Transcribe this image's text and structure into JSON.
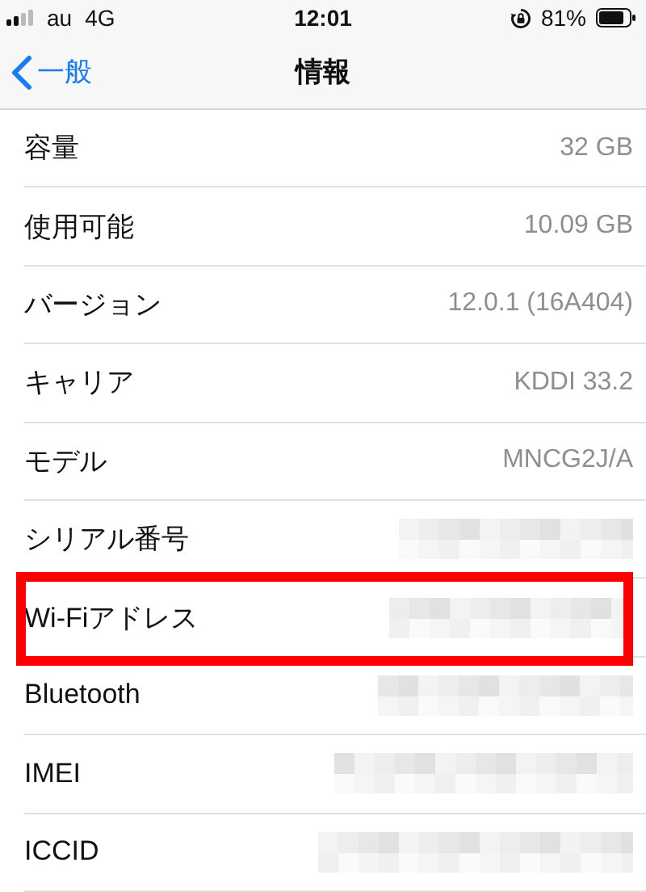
{
  "status_bar": {
    "carrier": "au",
    "network": "4G",
    "time": "12:01",
    "battery_percent": "81%"
  },
  "nav_bar": {
    "back_label": "一般",
    "title": "情報"
  },
  "rows": [
    {
      "label": "容量",
      "kind": "text",
      "value": "32 GB",
      "highlighted": false
    },
    {
      "label": "使用可能",
      "kind": "text",
      "value": "10.09 GB",
      "highlighted": false
    },
    {
      "label": "バージョン",
      "kind": "text",
      "value": "12.0.1 (16A404)",
      "highlighted": false
    },
    {
      "label": "キャリア",
      "kind": "text",
      "value": "KDDI 33.2",
      "highlighted": false
    },
    {
      "label": "モデル",
      "kind": "text",
      "value": "MNCG2J/A",
      "highlighted": false
    },
    {
      "label": "シリアル番号",
      "kind": "redacted",
      "highlighted": false
    },
    {
      "label": "Wi-Fiアドレス",
      "kind": "redacted",
      "highlighted": true
    },
    {
      "label": "Bluetooth",
      "kind": "redacted",
      "highlighted": false
    },
    {
      "label": "IMEI",
      "kind": "redacted",
      "highlighted": false
    },
    {
      "label": "ICCID",
      "kind": "redacted",
      "highlighted": false
    }
  ]
}
